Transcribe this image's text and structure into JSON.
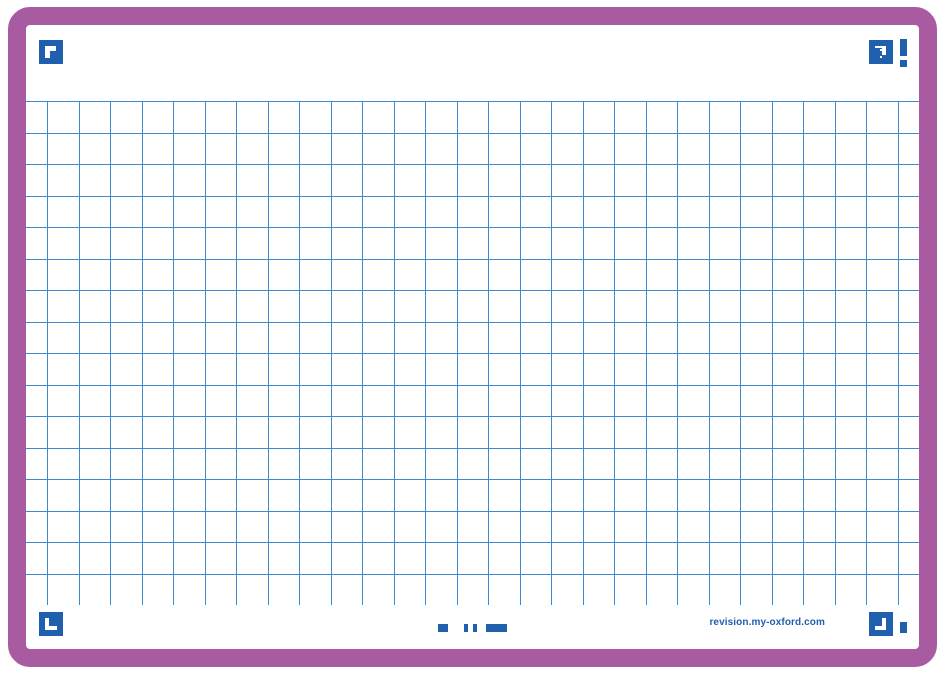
{
  "colors": {
    "border": "#a95ba1",
    "grid_line": "#3d8ad0",
    "brand_blue": "#1f5fae"
  },
  "grid": {
    "columns": 28,
    "rows": 16
  },
  "footer": {
    "url": "revision.my-oxford.com"
  },
  "icons": {
    "top_left": "corner-mark-icon",
    "top_right": "question-mark-icon",
    "top_right_extra": "exclamation-icon",
    "bottom_left": "corner-mark-icon",
    "bottom_center": "dash-pattern-icon",
    "bottom_right": "corner-mark-icon",
    "bottom_right_extra": "bar-icon"
  }
}
